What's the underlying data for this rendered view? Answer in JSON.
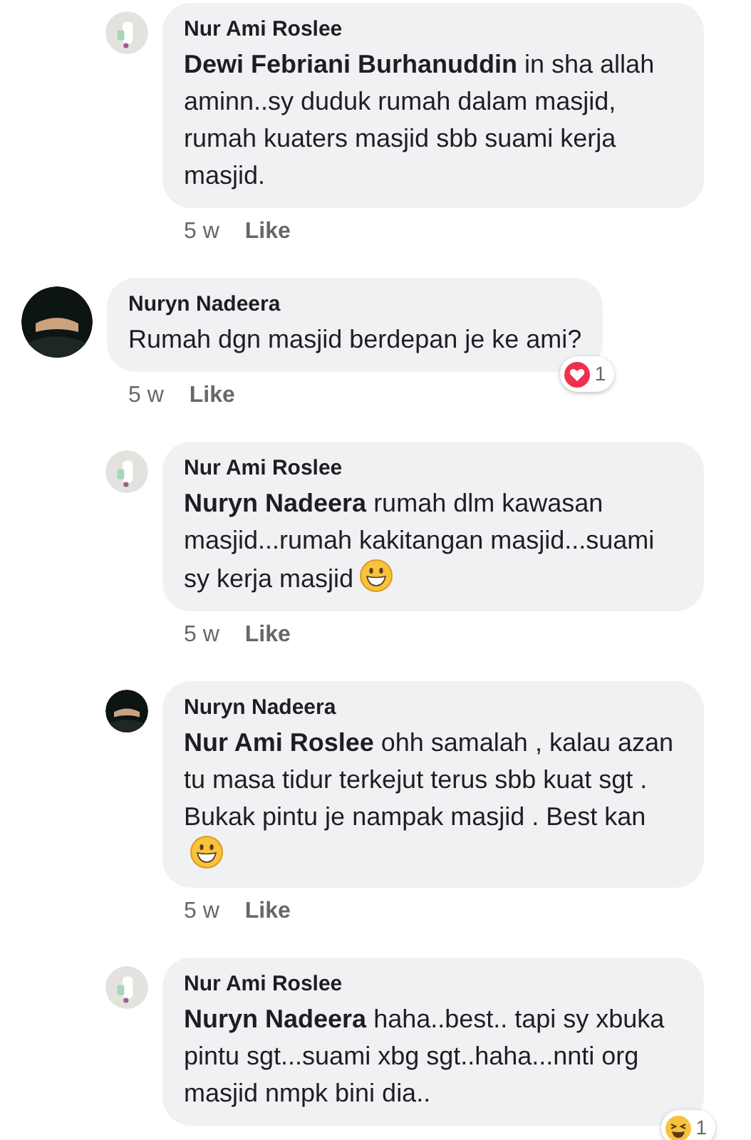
{
  "comments": [
    {
      "reply": true,
      "color": "#e4e2df",
      "author": "Nur Ami Roslee",
      "text": "**Dewi Febriani Burhanuddin** in sha allah aminn..sy duduk rumah dalam masjid, rumah kuaters masjid sbb suami kerja masjid.",
      "emoji": false,
      "time": "5 w",
      "like": "Like"
    },
    {
      "reply": false,
      "color": "#0d1414",
      "author": "Nuryn Nadeera",
      "text": "Rumah dgn masjid berdepan je ke ami?",
      "emoji": false,
      "time": "5 w",
      "like": "Like",
      "reaction": {
        "kind": "love",
        "count": "1"
      }
    },
    {
      "reply": true,
      "color": "#e4e2df",
      "author": "Nur Ami Roslee",
      "text": "**Nuryn Nadeera** rumah dlm kawasan masjid...rumah kakitangan masjid...suami sy kerja masjid",
      "emoji": true,
      "time": "5 w",
      "like": "Like"
    },
    {
      "reply": true,
      "color": "#0d1414",
      "author": "Nuryn Nadeera",
      "text": "**Nur Ami Roslee** ohh samalah , kalau azan tu masa tidur terkejut terus sbb kuat sgt . Bukak pintu je nampak masjid . Best kan",
      "emoji": true,
      "time": "5 w",
      "like": "Like"
    },
    {
      "reply": true,
      "color": "#e4e2df",
      "author": "Nur Ami Roslee",
      "text": "**Nuryn Nadeera** haha..best.. tapi sy xbuka pintu sgt...suami xbg sgt..haha...nnti org masjid nmpk bini dia..",
      "emoji": false,
      "reaction": {
        "kind": "haha",
        "count": "1"
      }
    }
  ]
}
